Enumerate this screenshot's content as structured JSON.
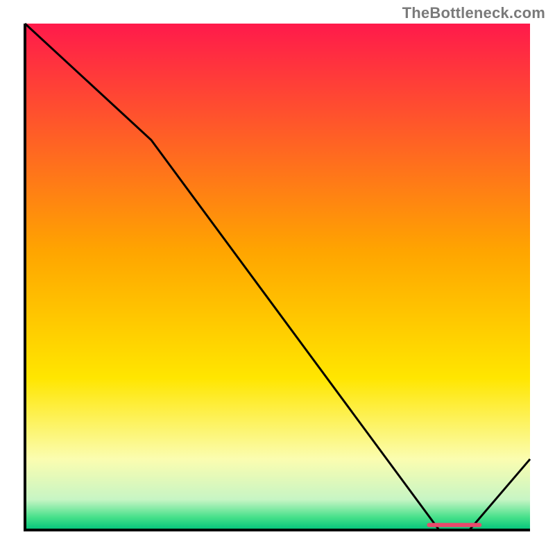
{
  "watermark": "TheBottleneck.com",
  "chart_data": {
    "type": "line",
    "title": "",
    "xlabel": "",
    "ylabel": "",
    "xlim": [
      0,
      100
    ],
    "ylim": [
      0,
      100
    ],
    "grid": false,
    "x": [
      0,
      25,
      82,
      88,
      100
    ],
    "values": [
      100,
      77,
      0,
      0,
      14
    ],
    "marker_segment_x": [
      80,
      90
    ],
    "marker_segment_y": [
      1,
      1
    ],
    "gradient_stops": [
      {
        "pct": 0.0,
        "color": "#ff1a4b"
      },
      {
        "pct": 0.45,
        "color": "#ffa500"
      },
      {
        "pct": 0.7,
        "color": "#ffe600"
      },
      {
        "pct": 0.86,
        "color": "#fbfdb0"
      },
      {
        "pct": 0.94,
        "color": "#c7f5c4"
      },
      {
        "pct": 0.975,
        "color": "#46e08a"
      },
      {
        "pct": 1.0,
        "color": "#00c27a"
      }
    ],
    "line_color": "#000000",
    "marker_color": "#e9496b",
    "axis_color": "#000000"
  }
}
